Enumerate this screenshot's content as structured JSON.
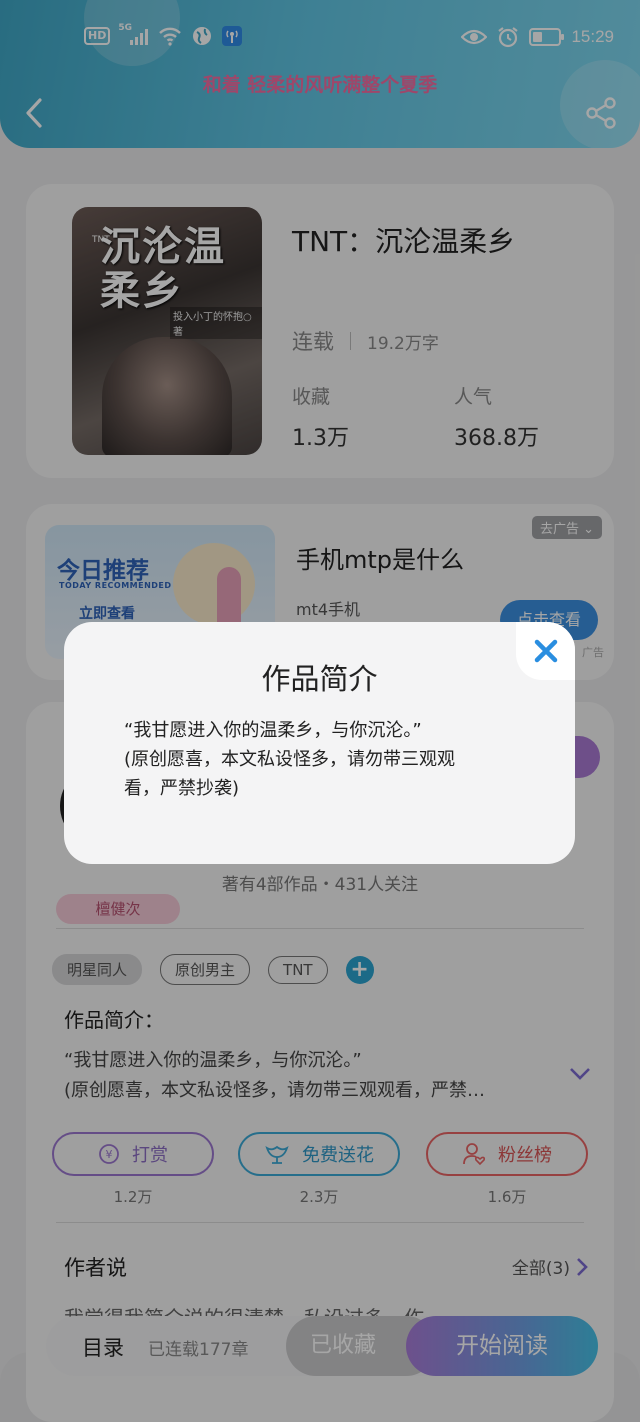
{
  "status_bar": {
    "hd": "HD",
    "network": "5G",
    "time": "15:29"
  },
  "header": {
    "marquee": "和着 轻柔的风听满整个夏季"
  },
  "book": {
    "title": "TNT：沉沦温柔乡",
    "cover_title": "沉沦温柔乡",
    "cover_series": "TNT",
    "cover_author": "投入小丁的怀抱○著",
    "status": "连载",
    "word_count": "19.2万字",
    "favorites_label": "收藏",
    "favorites_value": "1.3万",
    "popularity_label": "人气",
    "popularity_value": "368.8万"
  },
  "ad": {
    "image_title": "今日推荐",
    "image_subtitle": "TODAY RECOMMENDED",
    "image_cta": "立即查看",
    "remove_label": "去广告",
    "title": "手机mtp是什么",
    "subtitle": "mt4手机",
    "button": "点击查看",
    "tag": "广告"
  },
  "author": {
    "stats": "著有4部作品・431人关注",
    "badge": "檀健次"
  },
  "tags": [
    "明星同人",
    "原创男主",
    "TNT"
  ],
  "intro": {
    "label": "作品简介：",
    "line1": "“我甘愿进入你的温柔乡，与你沉沦。”",
    "line2": "(原创愿喜，本文私设怪多，请勿带三观观看，严禁…"
  },
  "actions": [
    {
      "label": "打赏",
      "count": "1.2万"
    },
    {
      "label": "免费送花",
      "count": "2.3万"
    },
    {
      "label": "粉丝榜",
      "count": "1.6万"
    }
  ],
  "author_say": {
    "label": "作者说",
    "all": "全部(3)",
    "peek": "我觉得我简介说的很清楚，私设过多，作"
  },
  "bottom_bar": {
    "menu": "目录",
    "chapters": "已连载177章",
    "favorited": "已收藏",
    "start_reading": "开始阅读"
  },
  "modal": {
    "title": "作品简介",
    "line1": "“我甘愿进入你的温柔乡，与你沉沦。”",
    "line2": "(原创愿喜，本文私设怪多，请勿带三观观",
    "line3": "看，严禁抄袭)"
  },
  "colors": {
    "header_start": "#3fa7c6",
    "header_end": "#7fd7ef",
    "marquee": "#f36ea3",
    "close_icon": "#2a8ee0",
    "read_button_start": "#a87cd8",
    "read_button_end": "#47c2e6"
  }
}
